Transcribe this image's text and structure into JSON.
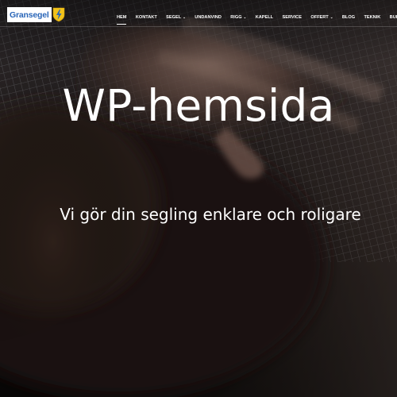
{
  "header": {
    "logo_text": "Gransegel",
    "nav": [
      {
        "label": "HEM",
        "active": true,
        "has_dropdown": false
      },
      {
        "label": "KONTAKT",
        "active": false,
        "has_dropdown": false
      },
      {
        "label": "SEGEL",
        "active": false,
        "has_dropdown": true
      },
      {
        "label": "UNDANVIND",
        "active": false,
        "has_dropdown": false
      },
      {
        "label": "RIGG",
        "active": false,
        "has_dropdown": true
      },
      {
        "label": "KAPELL",
        "active": false,
        "has_dropdown": false
      },
      {
        "label": "SERVICE",
        "active": false,
        "has_dropdown": false
      },
      {
        "label": "OFFERT",
        "active": false,
        "has_dropdown": true
      },
      {
        "label": "BLOG",
        "active": false,
        "has_dropdown": false
      },
      {
        "label": "TEKNIK",
        "active": false,
        "has_dropdown": false
      },
      {
        "label": "BULLANDÖ",
        "active": false,
        "has_dropdown": false
      }
    ]
  },
  "hero": {
    "title": "WP-hemsida",
    "subtitle": "Vi gör din segling enklare och roligare"
  },
  "icons": {
    "logo_badge": "shield-lightning-icon",
    "dropdown_caret": "chevron-down-icon"
  },
  "colors": {
    "logo_blue": "#2a66b8",
    "logo_badge_yellow": "#f2c21a",
    "text": "#ffffff"
  }
}
